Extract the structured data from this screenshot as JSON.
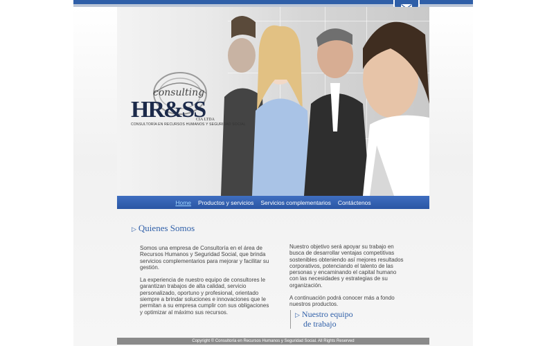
{
  "header": {
    "mail_icon": "envelope-icon"
  },
  "logo": {
    "script": "consulting",
    "main": "HR&SS",
    "cia": "CIA LTDA",
    "subtitle": "CONSULTORÍA EN RECURSOS HUMANOS Y SEGURIDAD SOCIAL"
  },
  "nav": {
    "items": [
      {
        "label": "Home",
        "active": true
      },
      {
        "label": "Productos y servicios"
      },
      {
        "label": "Servicios complementarios"
      },
      {
        "label": "Contáctenos"
      }
    ]
  },
  "main": {
    "section_title": "Quienes Somos",
    "left_p1": "Somos una empresa de Consultoría en el área de Recursos Humanos y Seguridad Social, que brinda servicios complementarios para mejorar y facilitar su gestión.",
    "left_p2": "La experiencia de nuestro equipo de consultores le garantizan trabajos de alta calidad, servicio personalizado, oportuno y profesional, orientado siempre a brindar soluciones e innovaciones que le permitan a su empresa cumplir con sus obligaciones y optimizar al máximo sus recursos.",
    "right_p1": "Nuestro objetivo será apoyar su trabajo en busca de desarrollar ventajas competitivas sostenibles obteniendo así mejores resultados corporativos, potenciando el talento de las personas y encaminando el capital humano con las necesidades y estrategias de su organización.",
    "right_p2": "A continuación podrá conocer más a fondo nuestros productos.",
    "team_link_line1": "Nuestro equipo",
    "team_link_line2": "de trabajo"
  },
  "footer": {
    "text": "Copyright © Consultoría en Recursos Humanos y Seguridad Social. All Rights Reserved"
  },
  "colors": {
    "brand_blue": "#2f5fa8",
    "nav_active": "#9fd5ff",
    "footer_bg": "#8a8a8a"
  }
}
